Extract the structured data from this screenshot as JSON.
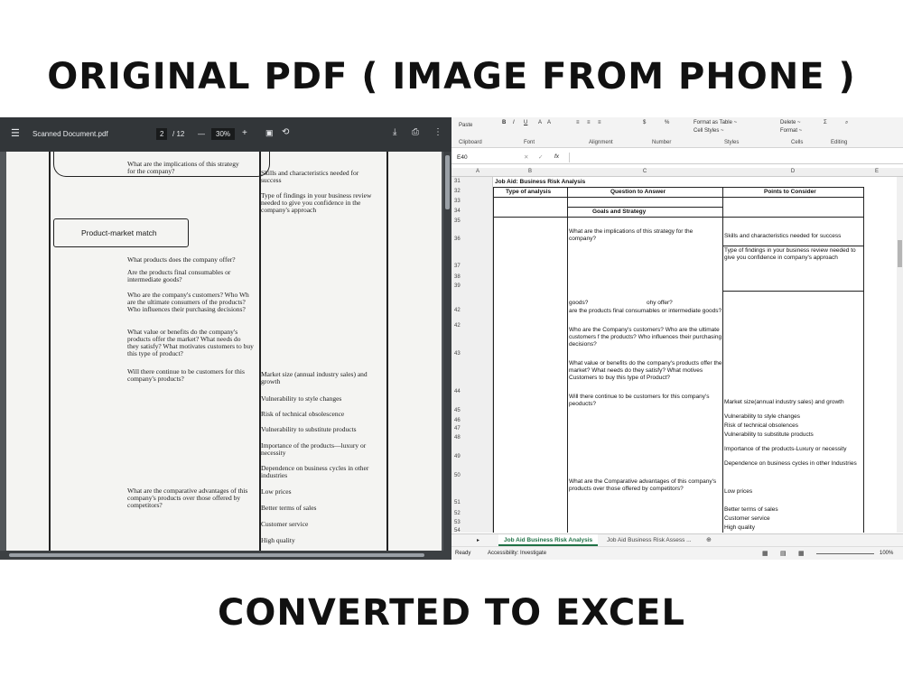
{
  "headings": {
    "top": "ORIGINAL PDF ( IMAGE FROM PHONE )",
    "bottom": "CONVERTED TO EXCEL"
  },
  "pdf": {
    "file_name": "Scanned Document.pdf",
    "page_current": "2",
    "page_total": "/ 12",
    "zoom": "30%",
    "section_title": "Product-market match",
    "left_col": [
      "What are the implications of this strategy for the company?",
      "What products does the company offer?",
      "Are the products final consumables or intermediate goods?",
      "Who are the company's customers? Who Wh are the ultimate consumers of the products? Who influences their purchasing decisions?",
      "What value or benefits do the company's products offer the market? What needs do they satisfy? What motivates customers to buy this type of product?",
      "Will there continue to be customers for this company's products?",
      "What are the comparative advantages of this company's products over those offered by competitors?"
    ],
    "right_col": [
      "Skills and characteristics needed for success",
      "Type of findings in your business review needed to give you confidence in the company's approach",
      "Market size (annual industry sales) and growth",
      "Vulnerability to style changes",
      "Risk of technical obsolescence",
      "Vulnerability to substitute products",
      "Importance of the products—luxury or necessity",
      "Dependence on business cycles in other industries",
      "Low prices",
      "Better terms of sales",
      "Customer service",
      "High quality"
    ]
  },
  "excel": {
    "ribbon_groups": [
      "Clipboard",
      "Font",
      "Alignment",
      "Number",
      "Styles",
      "Cells",
      "Editing"
    ],
    "ribbon_items": {
      "paste": "Paste",
      "format_table": "Format as Table ~",
      "cell_styles": "Cell Styles ~",
      "delete": "Delete ~",
      "format": "Format ~"
    },
    "name_box": "E40",
    "fx": "fx",
    "columns": [
      "A",
      "B",
      "C",
      "D",
      "E"
    ],
    "rows": [
      "31",
      "32",
      "33",
      "34",
      "35",
      "36",
      "37",
      "38",
      "39",
      "42",
      "42",
      "43",
      "44",
      "45",
      "46",
      "47",
      "48",
      "49",
      "50",
      "51",
      "52",
      "53",
      "54"
    ],
    "cells": {
      "title": "Job Aid: Business Risk Analysis",
      "h_type": "Type of analysis",
      "h_question": "Question to Answer",
      "h_points": "Points to Consider",
      "goals": "Goals and Strategy",
      "q_impl": "What are the implications of this strategy for the company?",
      "p_skills": "Skills and characteristics needed for success",
      "p_findings": "Type of findings in your business review needed to give you confidence in company's approach",
      "q_goods": "goods?",
      "q_offer": "ohy offer?",
      "q_final": "are the products final consumables or intermediate goods?",
      "q_customers": "Who are the Company's customers? Who are the ultimate customers f the products? Who influences their purchasing decisions?",
      "q_value": "What value or benefits do the company's products offer the market? What needs do they satisfy? What motives Customers to buy this type of Product?",
      "q_continue": "Will there continue to be customers for this company's peoducts?",
      "p_market": "Market size(annual industry sales) and growth",
      "p_style": "Vulnerability to style changes",
      "p_risk": "Risk of technical obsolences",
      "p_subst": "Vulnerability to substitute products",
      "p_importance": "Importance of the products-Luxury or necessity",
      "p_dependence": "Dependence on business cycles in other Industries",
      "q_comparative": "What are the Comparative advantages of this company's products over those offered by competitors?",
      "p_low": "Low prices",
      "p_better": "Better terms of sales",
      "p_service": "Customer service",
      "p_quality": "High quality"
    },
    "tabs": [
      "Job Aid Business Risk Analysis",
      "Job Aid Business Risk Assess ..."
    ],
    "status": {
      "ready": "Ready",
      "accessibility": "Accessibility: Investigate",
      "zoom": "100%"
    }
  }
}
